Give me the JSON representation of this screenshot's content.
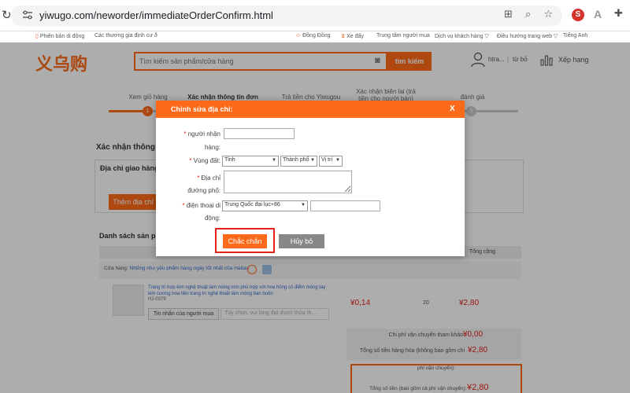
{
  "browser": {
    "url": "yiwugo.com/neworder/immediateOrderConfirm.html",
    "extension_s": "S",
    "extension_a": "A"
  },
  "site_top": {
    "mobile": "Phiên bản di động",
    "pricing": "Các thương gia định cư ð",
    "dongdong": "Đồng Đồng",
    "cart": "Xe đẩy",
    "buyer_center": "Trung tâm người mua",
    "customer_service": "Dịch vụ khách hàng ▽",
    "navigation": "Điều hướng trang web ▽",
    "language": "Tiếng Anh"
  },
  "header": {
    "logo": "义乌购",
    "search_placeholder": "Tìm kiếm sản phẩm/cửa hàng",
    "search_button": "tìm kiếm",
    "user": "htra...",
    "logout": "từ bỏ",
    "ranking": "Xếp hạng"
  },
  "steps": [
    {
      "label": "Xem giỏ hàng",
      "num": "1"
    },
    {
      "label": "Xác nhận thông tin đơn hàng",
      "num": ""
    },
    {
      "label": "Trả tiền cho Yiwugou",
      "num": ""
    },
    {
      "label": "Xác nhận biên lai (trả tiền cho người bán)",
      "num": ""
    },
    {
      "label": "đánh giá",
      "num": "5"
    }
  ],
  "page": {
    "confirm_title": "Xác nhận thông ti",
    "address_title": "Địa chỉ giao hàng",
    "add_address_btn": "Thêm địa chỉ",
    "product_list_title": "Danh sách sản phẩ",
    "col_total": "Tổng cộng",
    "shop_prefix": "Cửa hàng:",
    "shop_name": "Những nhu yếu phẩm hàng ngày tốt nhất của Haitao",
    "product_title": "Trang trí hợp kim nghệ thuật làm móng mới phù hợp với hoa hồng cỏ điểm móng tay kim cương hoa tiền trang trí nghệ thuật làm móng bán buôn",
    "product_sku": "HJ-0379",
    "note_btn": "Tin nhắn của người mua",
    "note_placeholder": "Tùy chọn, vui lòng đạt được thỏa th...",
    "unit_price": "¥0,14",
    "quantity": "20",
    "line_total": "¥2,80",
    "shipping_label": "Chi phí vận chuyển tham khảo:",
    "shipping_value": "¥0,00",
    "goods_total_label": "Tổng số tiền hàng hóa (không bao gồm chi",
    "goods_total_value": "¥2,80",
    "grand_top": "phí vận chuyển):",
    "grand_label": "Tổng số tiền (bao gồm cả phí vận chuyển):",
    "grand_value": "¥2,80"
  },
  "modal": {
    "title": "Chỉnh sửa địa chỉ:",
    "close": "X",
    "recipient_label": "người nhận",
    "recipient_label2": "hàng:",
    "recipient_value": "",
    "region_label": "Vùng đất:",
    "province": "Tỉnh",
    "city": "Thành phố",
    "district": "Vị trí",
    "street_label": "Địa chỉ",
    "street_label2": "đường phố:",
    "street_value": "",
    "phone_label": "điện thoại di",
    "phone_label2": "động:",
    "phone_country": "Trung Quốc đại lục+86",
    "phone_value": "",
    "confirm": "Chắc chắn",
    "cancel": "Hủy bỏ",
    "required_mark": "*"
  },
  "colors": {
    "brand_orange": "#ff6a1a",
    "price_red": "#e2231a",
    "highlight_border": "#e2231a"
  }
}
